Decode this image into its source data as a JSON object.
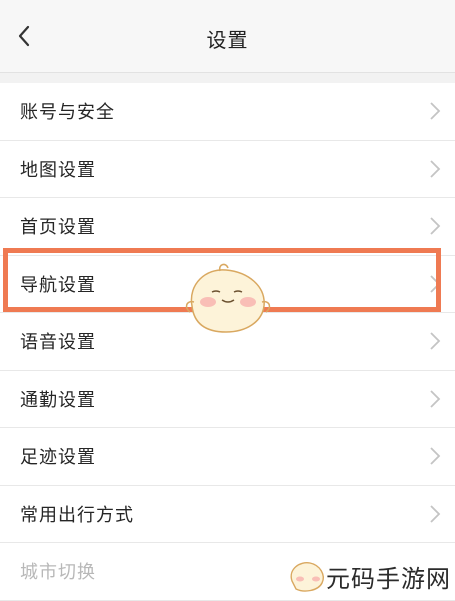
{
  "header": {
    "title": "设置"
  },
  "settings": {
    "items": [
      {
        "label": "账号与安全"
      },
      {
        "label": "地图设置"
      },
      {
        "label": "首页设置"
      },
      {
        "label": "导航设置"
      },
      {
        "label": "语音设置"
      },
      {
        "label": "通勤设置"
      },
      {
        "label": "足迹设置"
      },
      {
        "label": "常用出行方式"
      },
      {
        "label": "城市切换"
      }
    ]
  },
  "watermark": {
    "text": "元码手游网"
  },
  "colors": {
    "highlight": "#ef7a52",
    "chevron": "#c4c4c4"
  }
}
